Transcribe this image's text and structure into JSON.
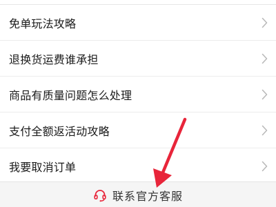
{
  "faq": {
    "items": [
      {
        "label": "免单玩法攻略"
      },
      {
        "label": "退换货运费谁承担"
      },
      {
        "label": "商品有质量问题怎么处理"
      },
      {
        "label": "支付全额返活动攻略"
      },
      {
        "label": "我要取消订单"
      }
    ]
  },
  "footer": {
    "contact_label": "联系官方客服"
  },
  "icons": {
    "row_chevron": "chevron-right-icon",
    "contact": "headset-icon",
    "annotation": "red-arrow"
  },
  "colors": {
    "accent": "#e8253a",
    "text": "#1a1a1a",
    "chevron": "#b8b8b8",
    "footer_bg": "#f5f5f5"
  }
}
